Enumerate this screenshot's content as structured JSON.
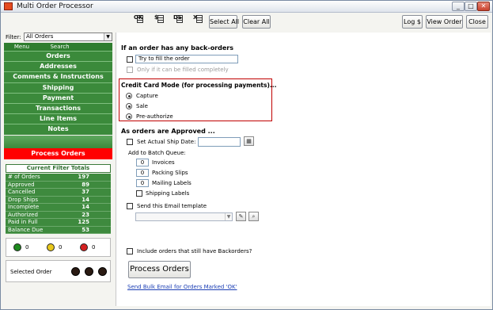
{
  "window": {
    "title": "Multi Order Processor",
    "minimize": "_",
    "maximize": "□",
    "close": "✕"
  },
  "toolbar": {
    "icons": [
      {
        "label": "OK",
        "icon": "ok-flag-icon"
      },
      {
        "label": "$",
        "icon": "dollar-flag-icon"
      },
      {
        "label": "DS",
        "icon": "drop-ship-flag-icon"
      },
      {
        "label": "X",
        "icon": "cancel-flag-icon"
      }
    ],
    "select_all": "Select All",
    "clear_all": "Clear All",
    "log": "Log $",
    "view_order": "View Order",
    "close": "Close"
  },
  "sidebar": {
    "filter_label": "Filter:",
    "filter_value": "All Orders",
    "menu_tabs": [
      "Menu",
      "Search"
    ],
    "nav": [
      "Orders",
      "Addresses",
      "Comments & Instructions",
      "Shipping",
      "Payment",
      "Transactions",
      "Line Items",
      "Notes"
    ],
    "process_orders": "Process Orders",
    "totals_title": "Current Filter Totals",
    "totals": [
      {
        "label": "# of Orders",
        "value": "197"
      },
      {
        "label": "Approved",
        "value": "89"
      },
      {
        "label": "Cancelled",
        "value": "37"
      },
      {
        "label": "Drop Ships",
        "value": "14"
      },
      {
        "label": "Incomplete",
        "value": "14"
      },
      {
        "label": "Authorized",
        "value": "23"
      },
      {
        "label": "Paid in Full",
        "value": "125"
      },
      {
        "label": "Balance Due",
        "value": "53"
      }
    ],
    "status_dots": [
      {
        "color": "#1e8a1e",
        "value": "0"
      },
      {
        "color": "#e8c81c",
        "value": "0"
      },
      {
        "color": "#d42020",
        "value": "0"
      }
    ],
    "selected_order_label": "Selected Order"
  },
  "main": {
    "backorders_title": "If an order has any back-orders",
    "try_fill": "Try to fill the order",
    "only_if": "Only if it can be filled completely",
    "cc_title": "Credit Card Mode (for processing payments)...",
    "cc_options": [
      "Capture",
      "Sale",
      "Pre-authorize"
    ],
    "approved_title": "As orders are Approved ...",
    "set_ship_date": "Set Actual Ship Date:",
    "batch_queue": "Add to Batch Queue:",
    "batch_items": [
      {
        "label": "Invoices",
        "value": "0"
      },
      {
        "label": "Packing Slips",
        "value": "0"
      },
      {
        "label": "Mailing Labels",
        "value": "0"
      }
    ],
    "shipping_labels": "Shipping Labels",
    "send_email": "Send this Email template",
    "include_backorders": "Include orders that still have Backorders?",
    "process_button": "Process Orders",
    "bulk_email_link": "Send Bulk Email for Orders Marked 'OK'"
  }
}
